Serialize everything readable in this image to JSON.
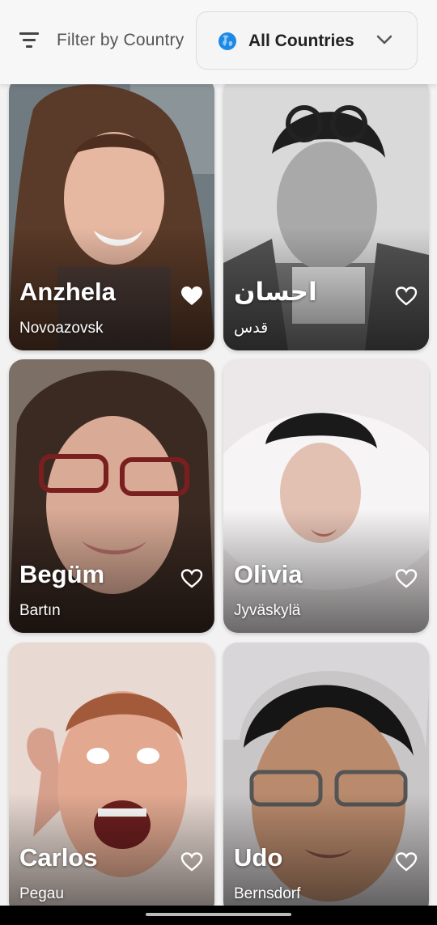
{
  "header": {
    "filter_label": "Filter by Country",
    "dropdown_value": "All Countries",
    "filter_icon": "filter-list-icon",
    "globe_icon": "globe-icon",
    "chevron_icon": "chevron-down-icon",
    "accent_color": "#1e88e5"
  },
  "profiles": [
    {
      "name": "Anzhela",
      "city": "Novoazovsk",
      "favorited": true
    },
    {
      "name": "احسان",
      "city": "قدس",
      "favorited": false
    },
    {
      "name": "Begüm",
      "city": "Bartın",
      "favorited": false
    },
    {
      "name": "Olivia",
      "city": "Jyväskylä",
      "favorited": false
    },
    {
      "name": "Carlos",
      "city": "Pegau",
      "favorited": false
    },
    {
      "name": "Udo",
      "city": "Bernsdorf",
      "favorited": false
    }
  ]
}
